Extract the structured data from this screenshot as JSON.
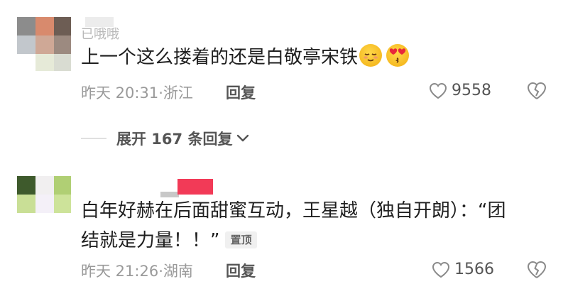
{
  "comments": [
    {
      "username": "已哦哦",
      "text": "上一个这么搂着的还是白敬亭宋铁",
      "emojis": [
        "relieved-face-emoji",
        "kissing-heart-eyes-emoji"
      ],
      "time": "昨天 20:31",
      "location": "浙江",
      "reply_label": "回复",
      "likes": "9558",
      "expand_label": "展开 167 条回复",
      "avatar_colors": [
        "#8c8c8c",
        "#d88a6d",
        "#6d5d54",
        "#c2c7cc",
        "#cfa896",
        "#e6ead8"
      ]
    },
    {
      "username": "",
      "text_line1": "白年好赫在后面甜蜜互动，王星越（独自开朗）：“团",
      "text_line2": "结就是力量！！”",
      "pinned_label": "置顶",
      "time": "昨天 21:26",
      "location": "湖南",
      "reply_label": "回复",
      "likes": "1566",
      "avatar_colors": [
        "#3e5a2c",
        "#f1eff0",
        "#dbe59a",
        "#b0cf74",
        "#f4f0f8",
        "#cde39a"
      ]
    }
  ],
  "colors": {
    "text": "#1f1f1f",
    "meta": "#9a9a9a",
    "action": "#555555"
  }
}
